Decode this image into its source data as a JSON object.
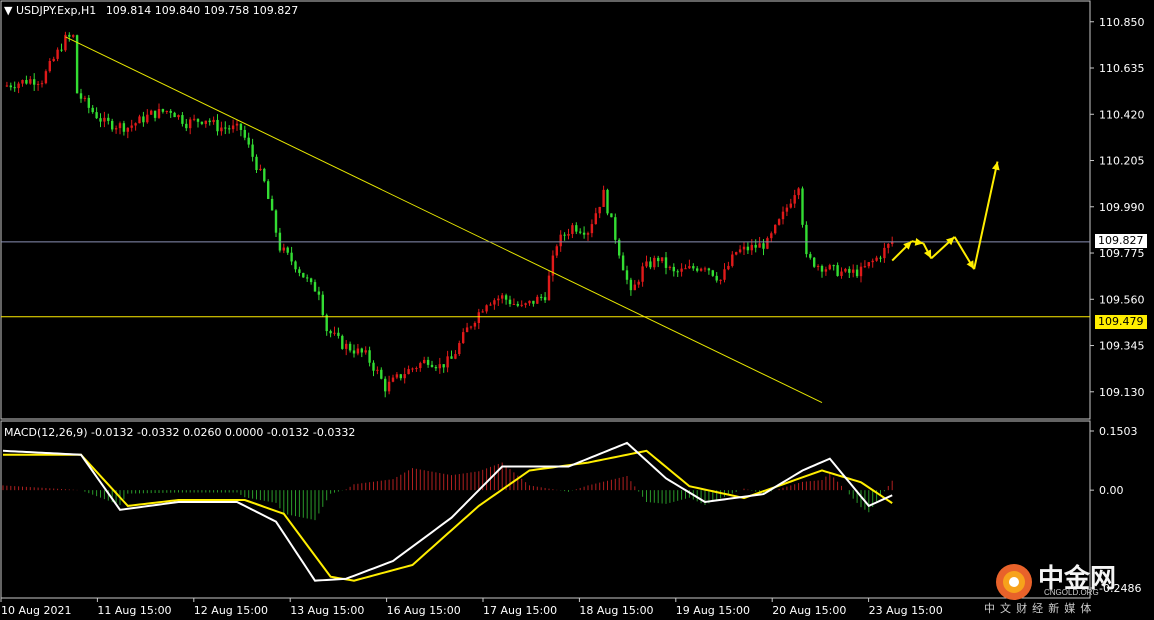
{
  "header": {
    "symbol": "USDJPY.Exp,H1",
    "ohlc": "109.814 109.840 109.758 109.827",
    "macd": "MACD(12,26,9) -0.0132 -0.0332 0.0260 0.0000 -0.0132 -0.0332"
  },
  "price_tags": {
    "current": "109.827",
    "support": "109.479"
  },
  "colors": {
    "bull": "#e01a1a",
    "bear": "#33dd33",
    "trendline": "#e6e600",
    "support_line": "#ffee00",
    "current_line": "#8a8fb5",
    "forecast": "#ffee00",
    "macd_main": "#ffffff",
    "macd_signal": "#ffee00"
  },
  "watermark": {
    "brand": "中金网",
    "domain": "CNGOLD.ORG",
    "slogan": "中 文 财 经 新 媒 体"
  },
  "chart_data": [
    {
      "type": "candlestick",
      "title": "USDJPY.Exp,H1",
      "ylim": [
        109.05,
        110.9
      ],
      "y_ticks": [
        "110.850",
        "110.635",
        "110.420",
        "110.205",
        "109.990",
        "109.775",
        "109.560",
        "109.345",
        "109.130"
      ],
      "x_ticks": [
        "10 Aug 2021",
        "11 Aug 15:00",
        "12 Aug 15:00",
        "13 Aug 15:00",
        "16 Aug 15:00",
        "17 Aug 15:00",
        "18 Aug 15:00",
        "19 Aug 15:00",
        "20 Aug 15:00",
        "23 Aug 15:00"
      ],
      "close_path": [
        [
          0,
          110.55
        ],
        [
          7,
          110.58
        ],
        [
          10,
          110.58
        ],
        [
          16,
          110.77
        ],
        [
          18,
          110.78
        ],
        [
          19,
          110.52
        ],
        [
          22,
          110.45
        ],
        [
          26,
          110.38
        ],
        [
          32,
          110.36
        ],
        [
          38,
          110.42
        ],
        [
          43,
          110.44
        ],
        [
          47,
          110.38
        ],
        [
          52,
          110.4
        ],
        [
          55,
          110.36
        ],
        [
          61,
          110.35
        ],
        [
          67,
          110.1
        ],
        [
          71,
          109.8
        ],
        [
          75,
          109.72
        ],
        [
          79,
          109.62
        ],
        [
          81,
          109.6
        ],
        [
          83,
          109.42
        ],
        [
          87,
          109.35
        ],
        [
          93,
          109.3
        ],
        [
          96,
          109.22
        ],
        [
          98,
          109.15
        ],
        [
          103,
          109.22
        ],
        [
          109,
          109.28
        ],
        [
          112,
          109.25
        ],
        [
          115,
          109.28
        ],
        [
          119,
          109.42
        ],
        [
          124,
          109.55
        ],
        [
          128,
          109.57
        ],
        [
          133,
          109.52
        ],
        [
          139,
          109.58
        ],
        [
          142,
          109.82
        ],
        [
          146,
          109.9
        ],
        [
          150,
          109.88
        ],
        [
          154,
          110.05
        ],
        [
          157,
          109.85
        ],
        [
          161,
          109.58
        ],
        [
          164,
          109.7
        ],
        [
          168,
          109.75
        ],
        [
          172,
          109.68
        ],
        [
          176,
          109.7
        ],
        [
          180,
          109.72
        ],
        [
          184,
          109.65
        ],
        [
          188,
          109.78
        ],
        [
          192,
          109.8
        ],
        [
          196,
          109.82
        ],
        [
          200,
          109.95
        ],
        [
          204,
          110.1
        ],
        [
          206,
          109.75
        ],
        [
          209,
          109.72
        ],
        [
          212,
          109.7
        ],
        [
          216,
          109.68
        ],
        [
          220,
          109.69
        ],
        [
          224,
          109.75
        ],
        [
          228,
          109.827
        ]
      ],
      "trendline": [
        [
          16,
          110.78
        ],
        [
          210,
          109.08
        ]
      ],
      "support_level": 109.479,
      "current_price": 109.827,
      "forecast_path": [
        [
          228,
          109.74
        ],
        [
          233,
          109.83
        ],
        [
          236,
          109.82
        ],
        [
          238,
          109.75
        ],
        [
          244,
          109.85
        ],
        [
          249,
          109.7
        ],
        [
          255,
          110.2
        ]
      ]
    },
    {
      "type": "line",
      "title": "MACD(12,26,9)",
      "ylim": [
        -0.2486,
        0.1503
      ],
      "y_ticks": [
        "0.1503",
        "0.00",
        "-0.2486"
      ],
      "series": [
        {
          "name": "MACD main",
          "points": [
            [
              0,
              0.1
            ],
            [
              20,
              0.09
            ],
            [
              30,
              -0.05
            ],
            [
              45,
              -0.03
            ],
            [
              60,
              -0.03
            ],
            [
              70,
              -0.08
            ],
            [
              80,
              -0.23
            ],
            [
              88,
              -0.225
            ],
            [
              100,
              -0.18
            ],
            [
              115,
              -0.07
            ],
            [
              128,
              0.06
            ],
            [
              145,
              0.06
            ],
            [
              160,
              0.12
            ],
            [
              170,
              0.03
            ],
            [
              180,
              -0.03
            ],
            [
              195,
              -0.01
            ],
            [
              205,
              0.05
            ],
            [
              212,
              0.08
            ],
            [
              222,
              -0.04
            ],
            [
              228,
              -0.013
            ]
          ]
        },
        {
          "name": "Signal",
          "points": [
            [
              0,
              0.09
            ],
            [
              20,
              0.09
            ],
            [
              32,
              -0.04
            ],
            [
              45,
              -0.025
            ],
            [
              62,
              -0.025
            ],
            [
              72,
              -0.06
            ],
            [
              84,
              -0.22
            ],
            [
              90,
              -0.23
            ],
            [
              105,
              -0.19
            ],
            [
              122,
              -0.04
            ],
            [
              135,
              0.05
            ],
            [
              150,
              0.07
            ],
            [
              165,
              0.1
            ],
            [
              176,
              0.01
            ],
            [
              190,
              -0.02
            ],
            [
              210,
              0.05
            ],
            [
              220,
              0.02
            ],
            [
              228,
              -0.033
            ]
          ]
        }
      ]
    }
  ]
}
